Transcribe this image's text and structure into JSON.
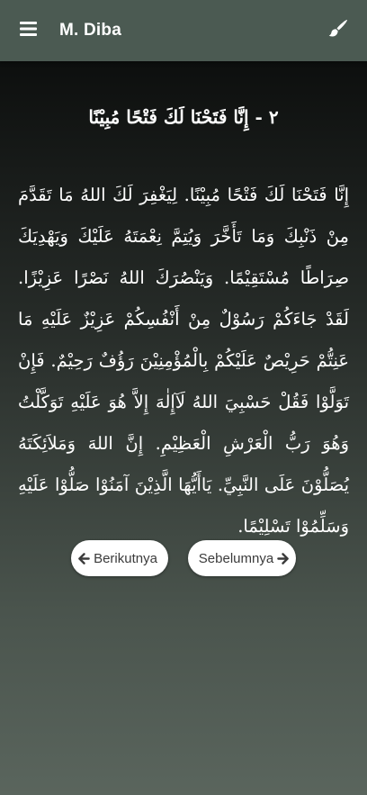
{
  "app": {
    "title": "M. Diba"
  },
  "icons": {
    "menu": "hamburger-menu-icon",
    "theme": "paint-brush-icon",
    "prev": "arrow-left-icon",
    "next": "arrow-right-icon"
  },
  "colors": {
    "appbar": "#4b5a52",
    "text": "#ffffff",
    "button_bg": "#ffffff",
    "button_text": "#3b3b3b"
  },
  "reading": {
    "heading": "٢ - إِنَّا فَتَحْنَا لَكَ فَتْحًا مُبِيْنًا",
    "text": "إِنَّا فَتَحْنَا لَكَ فَتْحًا مُبِيْنًا. لِيَغْفِرَ لَكَ اللهُ مَا تَقَدَّمَ مِنْ ذَنْبِكَ وَمَا تَأَخَّرَ وَيُتِمَّ نِعْمَتَهُ عَلَيْكَ وَيَهْدِيَكَ صِرَاطًا مُسْتَقِيْمًا. وَيَنْصُرَكَ اللهُ نَصْرًا عَزِيْزًا. لَقَدْ جَاءَكُمْ رَسُوْلٌ مِنْ أَنْفُسِكُمْ عَزِيْزٌ عَلَيْهِ مَا عَنِتُّمْ حَرِيْصٌ عَلَيْكُمْ بِالْمُؤْمِنِيْنَ رَؤُفٌ رَحِيْمٌ. فَإِنْ تَوَلَّوْا فَقُلْ حَسْبِيَ اللهُ لَآإِلٰهَ إِلاَّ هُوَ عَلَيْهِ تَوَكَّلْتُ وَهُوَ رَبُّ الْعَرْشِ الْعَظِيْمِ. إِنَّ اللهَ وَمَلاَئِكَتَهُ يُصَلُّوْنَ عَلَى النَّبِيِّ. يَاأَيُّهَا الَّذِيْنَ آمَنُوْا صَلُّوْا عَلَيْهِ وَسَلِّمُوْا تَسْلِيْمًا."
  },
  "navigation": {
    "prev_label": "Berikutnya",
    "next_label": "Sebelumnya"
  }
}
